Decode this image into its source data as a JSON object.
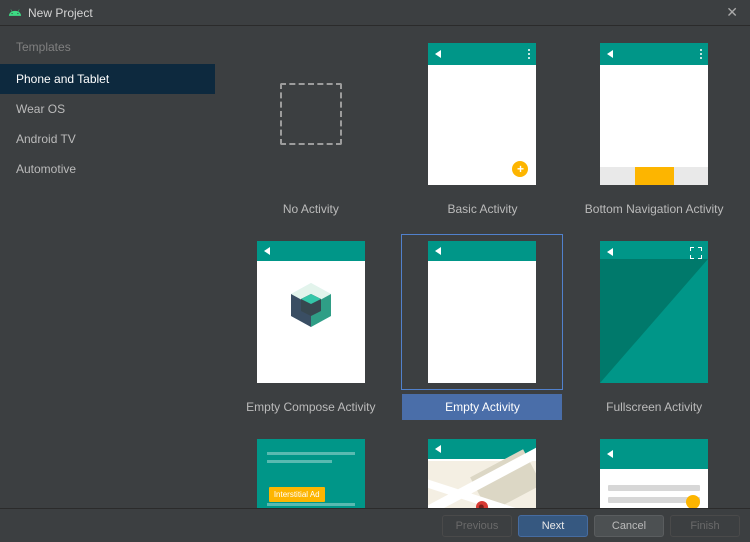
{
  "window": {
    "title": "New Project"
  },
  "sidebar": {
    "header": "Templates",
    "items": [
      {
        "label": "Phone and Tablet",
        "selected": true
      },
      {
        "label": "Wear OS",
        "selected": false
      },
      {
        "label": "Android TV",
        "selected": false
      },
      {
        "label": "Automotive",
        "selected": false
      }
    ]
  },
  "gallery": {
    "selected_index": 4,
    "items": [
      {
        "label": "No Activity"
      },
      {
        "label": "Basic Activity"
      },
      {
        "label": "Bottom Navigation Activity"
      },
      {
        "label": "Empty Compose Activity"
      },
      {
        "label": "Empty Activity"
      },
      {
        "label": "Fullscreen Activity"
      },
      {
        "label": ""
      },
      {
        "label": ""
      },
      {
        "label": ""
      }
    ],
    "interstitial_label": "Interstitial Ad"
  },
  "footer": {
    "previous": "Previous",
    "next": "Next",
    "cancel": "Cancel",
    "finish": "Finish"
  }
}
